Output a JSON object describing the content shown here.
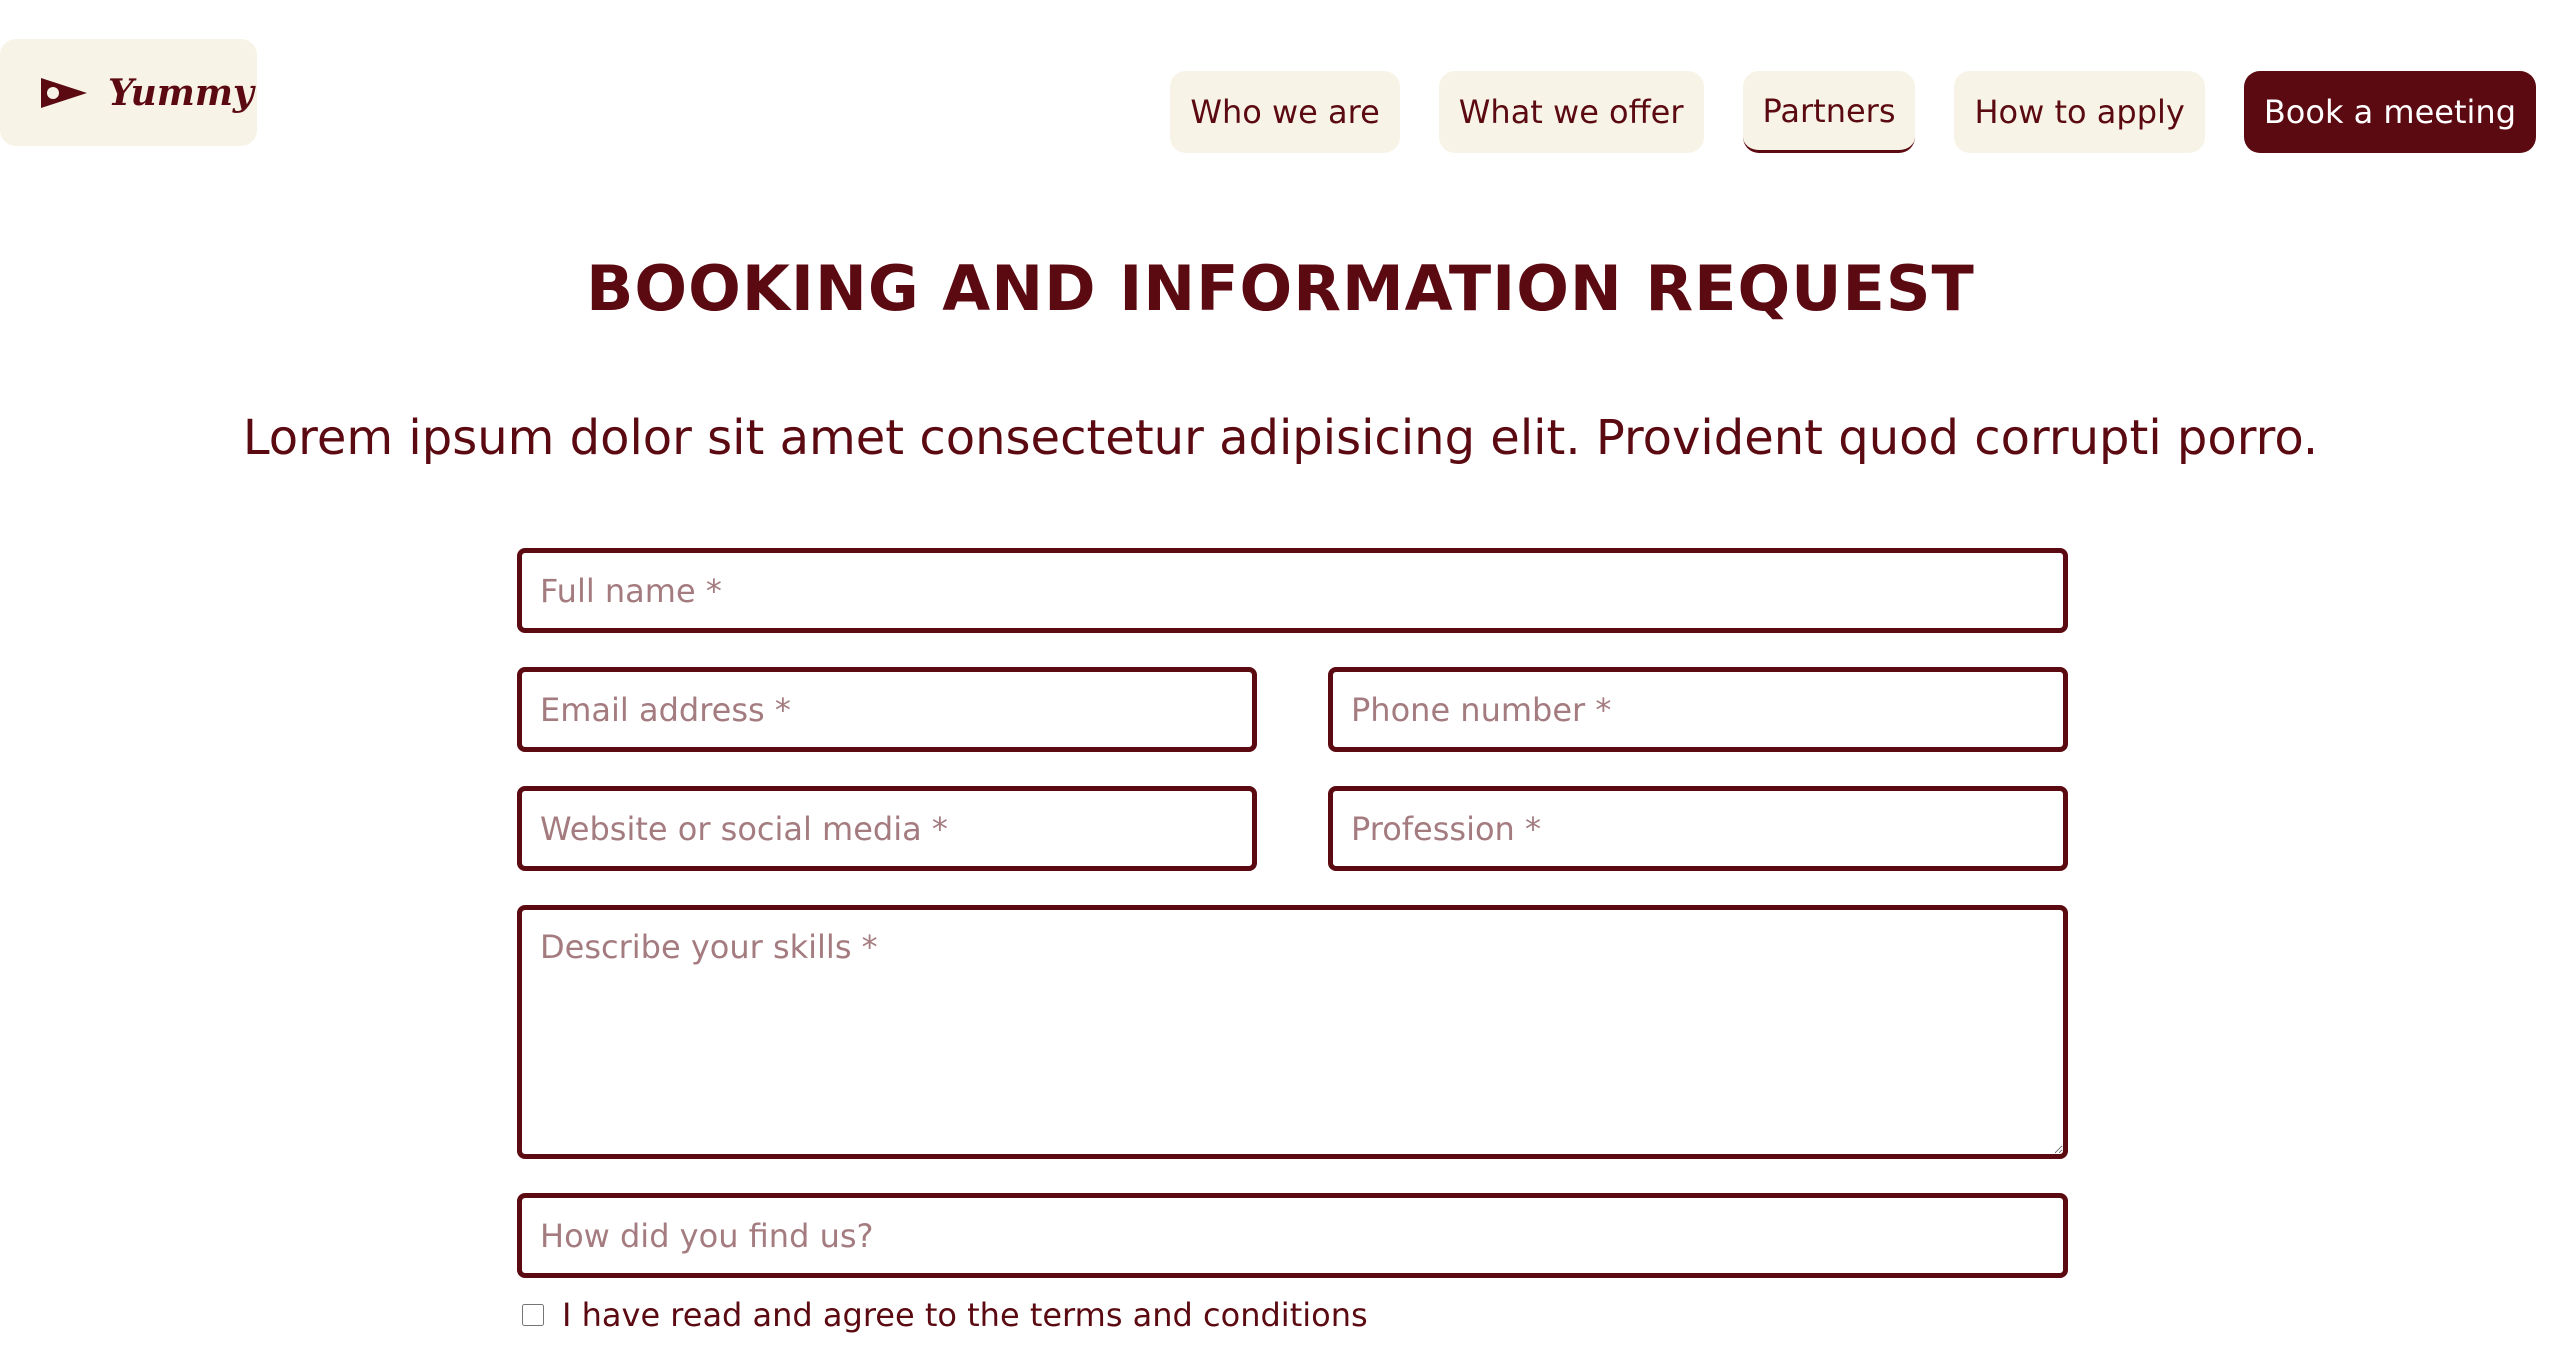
{
  "brand": {
    "name": "Yummy",
    "icon": "flag-play-icon"
  },
  "nav": {
    "items": [
      {
        "label": "Who we are"
      },
      {
        "label": "What we offer"
      },
      {
        "label": "Partners",
        "active": true
      },
      {
        "label": "How to apply"
      }
    ],
    "cta_label": "Book a meeting"
  },
  "page": {
    "title": "BOOKING AND INFORMATION REQUEST",
    "subtitle": "Lorem ipsum dolor sit amet consectetur adipisicing elit. Provident quod corrupti porro."
  },
  "form": {
    "full_name": {
      "placeholder": "Full name *",
      "value": ""
    },
    "email": {
      "placeholder": "Email address *",
      "value": ""
    },
    "phone": {
      "placeholder": "Phone number *",
      "value": ""
    },
    "website": {
      "placeholder": "Website or social media *",
      "value": ""
    },
    "profession": {
      "placeholder": "Profession *",
      "value": ""
    },
    "skills": {
      "placeholder": "Describe your skills *",
      "value": ""
    },
    "referral": {
      "placeholder": "How did you find us?",
      "value": ""
    },
    "terms": {
      "label": "I have read and agree to the terms and conditions",
      "checked": false
    }
  },
  "colors": {
    "brand": "#5c0a12",
    "nav_background": "#f7f4e7",
    "placeholder": "#a47c80",
    "page_background": "#ffffff"
  }
}
